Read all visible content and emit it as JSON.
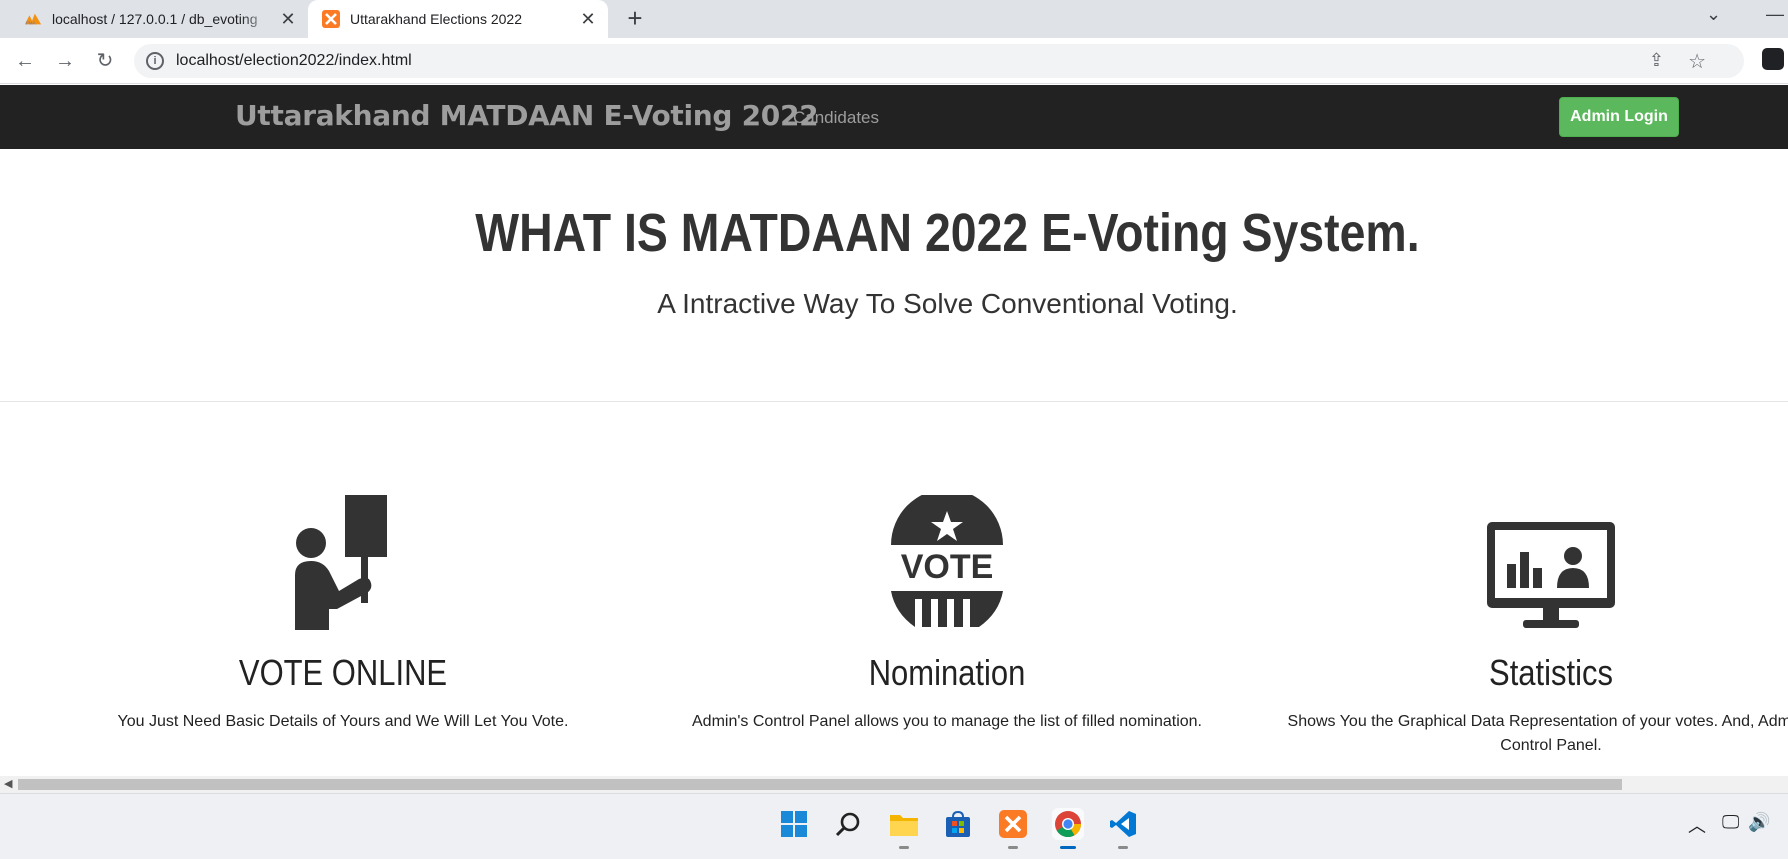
{
  "browser": {
    "tabs": [
      {
        "title": "localhost / 127.0.0.1 / db_evoting",
        "favicon": "phpmyadmin-icon"
      },
      {
        "title": "Uttarakhand Elections 2022",
        "favicon": "xampp-icon",
        "active": true
      }
    ],
    "url": "localhost/election2022/index.html"
  },
  "site": {
    "brand": "Uttarakhand MATDAAN E-Voting 2022",
    "nav_links": [
      "Candidates"
    ],
    "admin_button": "Admin Login",
    "accent_color": "#5cb85c",
    "navbar_color": "#222222"
  },
  "hero": {
    "title": "WHAT IS MATDAAN 2022 E-Voting System.",
    "subtitle": "A Intractive Way To Solve Conventional Voting."
  },
  "features": [
    {
      "icon": "voter-with-sign-icon",
      "heading": "VOTE ONLINE",
      "text": "You Just Need Basic Details of Yours and We Will Let You Vote."
    },
    {
      "icon": "vote-badge-icon",
      "heading": "Nomination",
      "text": "Admin's Control Panel allows you to manage the list of filled nomination."
    },
    {
      "icon": "monitor-statistics-icon",
      "heading": "Statistics",
      "text": "Shows You the Graphical Data Representation of your votes. And, Admin's Control Panel."
    }
  ],
  "taskbar": {
    "apps": [
      "start-icon",
      "search-icon",
      "file-explorer-icon",
      "store-icon",
      "xampp-icon",
      "chrome-icon",
      "vscode-icon"
    ]
  }
}
